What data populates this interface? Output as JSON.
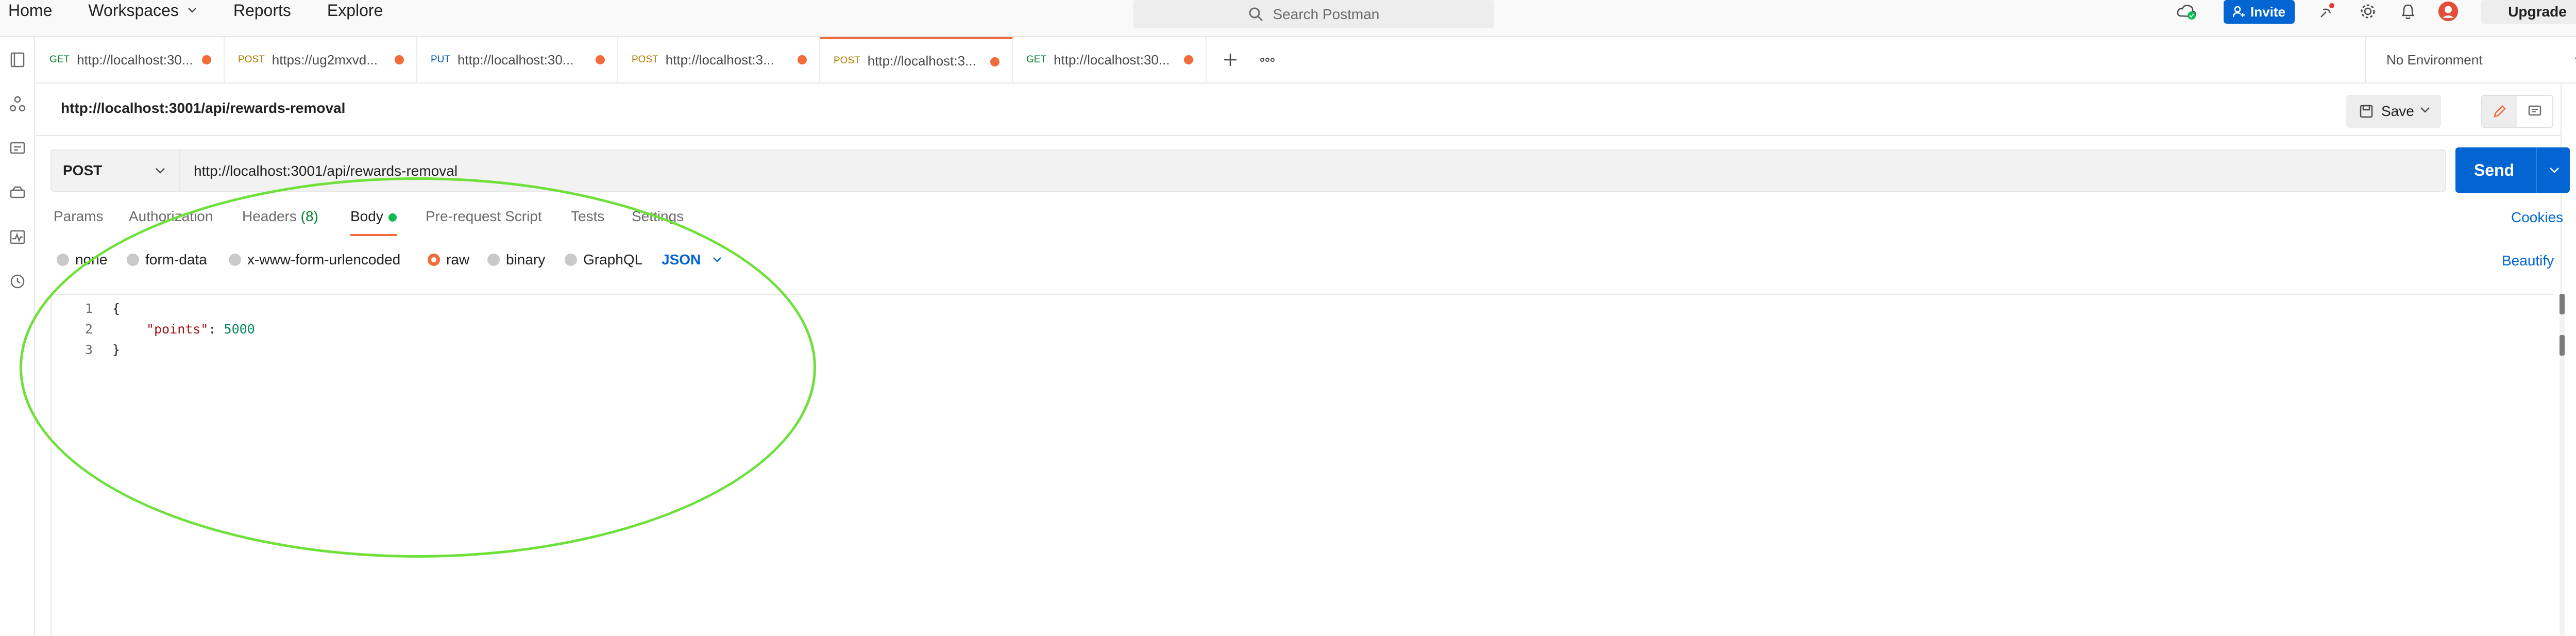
{
  "topbar": {
    "nav": [
      "Home",
      "Workspaces",
      "Reports",
      "Explore"
    ],
    "search_placeholder": "Search Postman",
    "invite_label": "Invite",
    "upgrade_label": "Upgrade"
  },
  "tabs": [
    {
      "method": "GET",
      "title": "http://localhost:30...",
      "active": false
    },
    {
      "method": "POST",
      "title": "https://ug2mxvd...",
      "active": false
    },
    {
      "method": "PUT",
      "title": "http://localhost:30...",
      "active": false
    },
    {
      "method": "POST",
      "title": "http://localhost:3...",
      "active": false
    },
    {
      "method": "POST",
      "title": "http://localhost:3...",
      "active": true
    },
    {
      "method": "GET",
      "title": "http://localhost:30...",
      "active": false
    }
  ],
  "environment": "No Environment",
  "request": {
    "title": "http://localhost:3001/api/rewards-removal",
    "save_label": "Save",
    "method": "POST",
    "url": "http://localhost:3001/api/rewards-removal",
    "send_label": "Send"
  },
  "request_tabs": {
    "params": "Params",
    "authorization": "Authorization",
    "headers": "Headers",
    "headers_count": "(8)",
    "body": "Body",
    "prerequest": "Pre-request Script",
    "tests": "Tests",
    "settings": "Settings",
    "cookies": "Cookies"
  },
  "body_types": {
    "none": "none",
    "form_data": "form-data",
    "urlencoded": "x-www-form-urlencoded",
    "raw": "raw",
    "binary": "binary",
    "graphql": "GraphQL",
    "format": "JSON",
    "beautify": "Beautify",
    "selected": "raw"
  },
  "editor": {
    "line_numbers": [
      "1",
      "2",
      "3"
    ],
    "line1": "{",
    "line2_key": "\"points\"",
    "line2_sep": ": ",
    "line2_value": "5000",
    "line3": "}"
  },
  "colors": {
    "accent": "#f26b3a",
    "primary": "#0265d2",
    "annotation": "#6ee03a"
  }
}
